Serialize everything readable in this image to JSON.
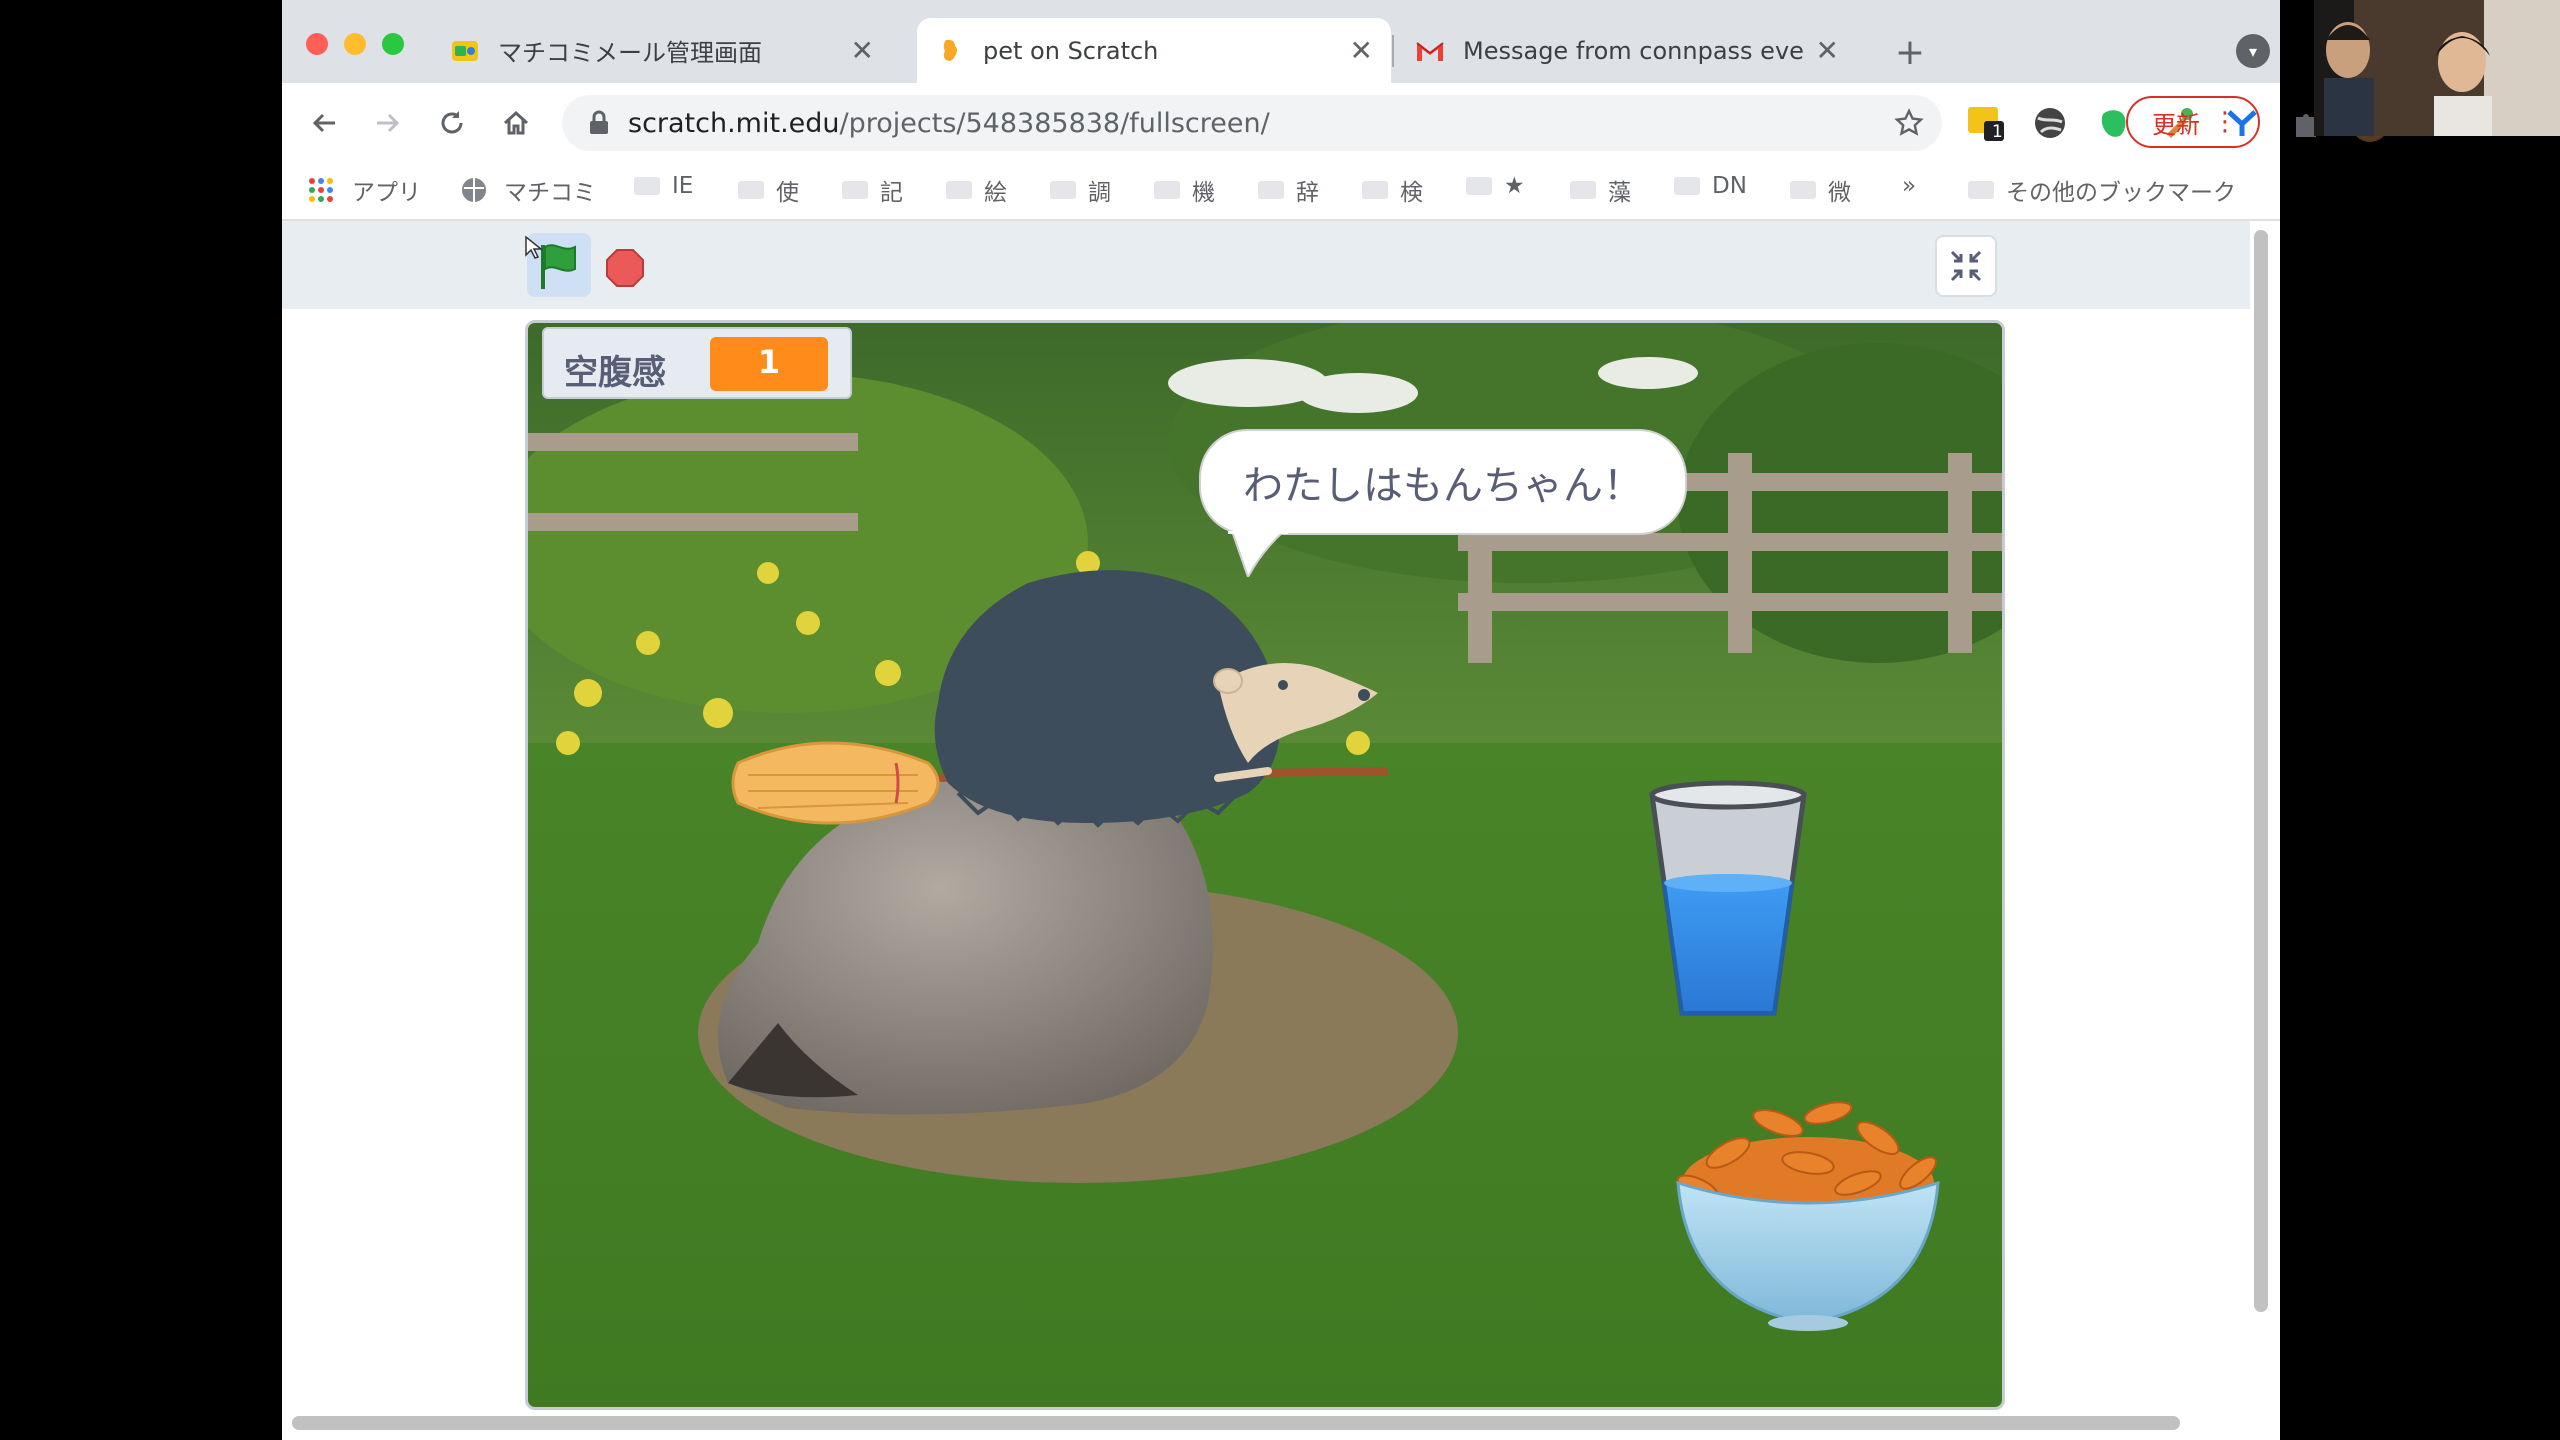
{
  "tabs": [
    {
      "title": "マチコミメール管理画面",
      "active": false
    },
    {
      "title": "pet on Scratch",
      "active": true
    },
    {
      "title": "Message from connpass event",
      "active": false
    }
  ],
  "address_bar": {
    "host": "scratch.mit.edu",
    "path": "/projects/548385838/fullscreen/"
  },
  "extensions": {
    "badge_count": "1"
  },
  "update_button": {
    "label": "更新"
  },
  "bookmarks": {
    "apps": "アプリ",
    "items": [
      "マチコミ",
      "IE",
      "使",
      "記",
      "絵",
      "調",
      "機",
      "辞",
      "検",
      "★",
      "藻",
      "DN",
      "微"
    ],
    "overflow": "»",
    "other": "その他のブックマーク"
  },
  "scratch": {
    "monitor": {
      "label": "空腹感",
      "value": "1"
    },
    "speech_bubble": "わたしはもんちゃん！"
  },
  "colors": {
    "accent_orange": "#ff8c1a",
    "flag_green": "#2e9f3a",
    "stop_red": "#ec5959",
    "update_red": "#d93025"
  }
}
